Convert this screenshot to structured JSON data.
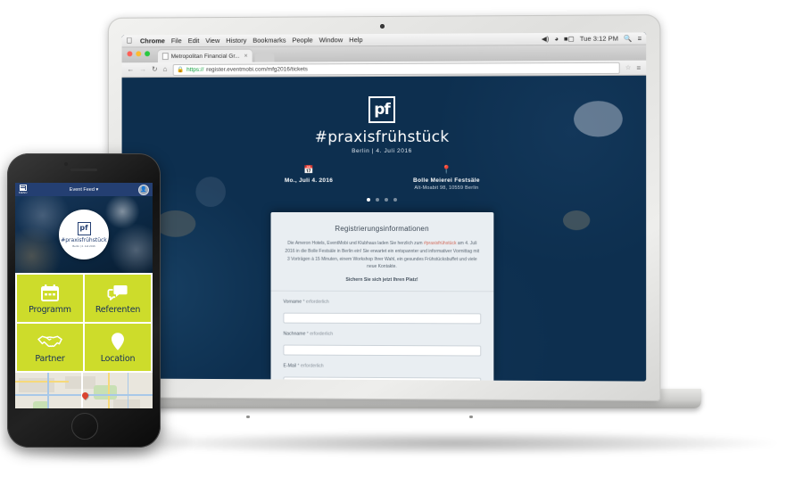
{
  "os": {
    "menubar": {
      "apple_icon": "apple-icon",
      "items": [
        "Chrome",
        "File",
        "Edit",
        "View",
        "History",
        "Bookmarks",
        "People",
        "Window",
        "Help"
      ],
      "status": {
        "volume_icon": "volume-icon",
        "wifi_icon": "wifi-icon",
        "battery_icon": "battery-icon",
        "clock": "Tue 3:12 PM",
        "search_icon": "search-icon",
        "menu_icon": "list-menu-icon"
      }
    }
  },
  "browser": {
    "traffic_lights": [
      "#ff5f57",
      "#febc2e",
      "#28c840"
    ],
    "tab_title": "Metropolitan Financial Gr...",
    "tab_close": "×",
    "new_tab_label": "",
    "nav": {
      "back_icon": "back-arrow-icon",
      "forward_icon": "forward-arrow-icon",
      "reload_icon": "reload-icon",
      "home_icon": "home-icon",
      "bookmark_icon": "star-icon",
      "settings_icon": "hamburger-menu-icon"
    },
    "url_scheme": "https://",
    "url_rest": "register.eventmobi.com/mfg2016/tickets",
    "lock_icon": "lock-icon"
  },
  "hero": {
    "logo_text": "pf",
    "title": "#praxisfrühstück",
    "subtitle": "Berlin | 4. Juli 2016",
    "date": {
      "icon": "calendar-icon",
      "line1": "Mo., Juli 4. 2016",
      "line2": ""
    },
    "venue": {
      "icon": "map-pin-icon",
      "line1": "Bolle Meierei Festsäle",
      "line2": "Alt-Moabit 98, 10559 Berlin"
    },
    "carousel_dots": 4,
    "carousel_active": 1
  },
  "registration": {
    "heading": "Registrierungsinformationen",
    "intro_before": "Die Ameron Hotels, EventMobi und Klubhaus laden Sie herzlich zum ",
    "intro_highlight": "#praxisfrühstück",
    "intro_after": " am 4. Juli 2016 in die Bolle Festsäle in Berlin ein! Sie erwartet ein entspannter und informativer Vormittag mit 3 Vorträgen à 15 Minuten, einem Workshop Ihrer Wahl, ein gesundes Frühstücksbuffet und viele neue Kontakte.",
    "cta": "Sichern Sie sich jetzt Ihren Platz!",
    "fields": [
      {
        "label": "Vorname",
        "required_text": "* erforderlich",
        "value": "",
        "placeholder": ""
      },
      {
        "label": "Nachname",
        "required_text": "* erforderlich",
        "value": "",
        "placeholder": ""
      },
      {
        "label": "E-Mail",
        "required_text": "* erforderlich",
        "value": "",
        "placeholder": ""
      }
    ]
  },
  "phone_app": {
    "menu_label": "MENU",
    "menu_icon": "grid-menu-icon",
    "title": "Event Feed",
    "title_caret": "▾",
    "avatar_icon": "user-avatar-icon",
    "badge": {
      "logo_text": "pf",
      "title": "#praxisfrühstück",
      "subtitle": "Berlin | 4. Juli 2016"
    },
    "tiles": [
      {
        "label": "Programm",
        "icon": "calendar-icon"
      },
      {
        "label": "Referenten",
        "icon": "speech-bubbles-icon"
      },
      {
        "label": "Partner",
        "icon": "handshake-icon"
      },
      {
        "label": "Location",
        "icon": "map-pin-icon"
      }
    ],
    "map": {
      "pin_icon": "map-pin-marker-icon"
    }
  },
  "colors": {
    "brand_lime": "#cddc2b",
    "brand_navy": "#243f72",
    "hero_navy": "#0b2742",
    "accent_red": "#d9432f"
  }
}
